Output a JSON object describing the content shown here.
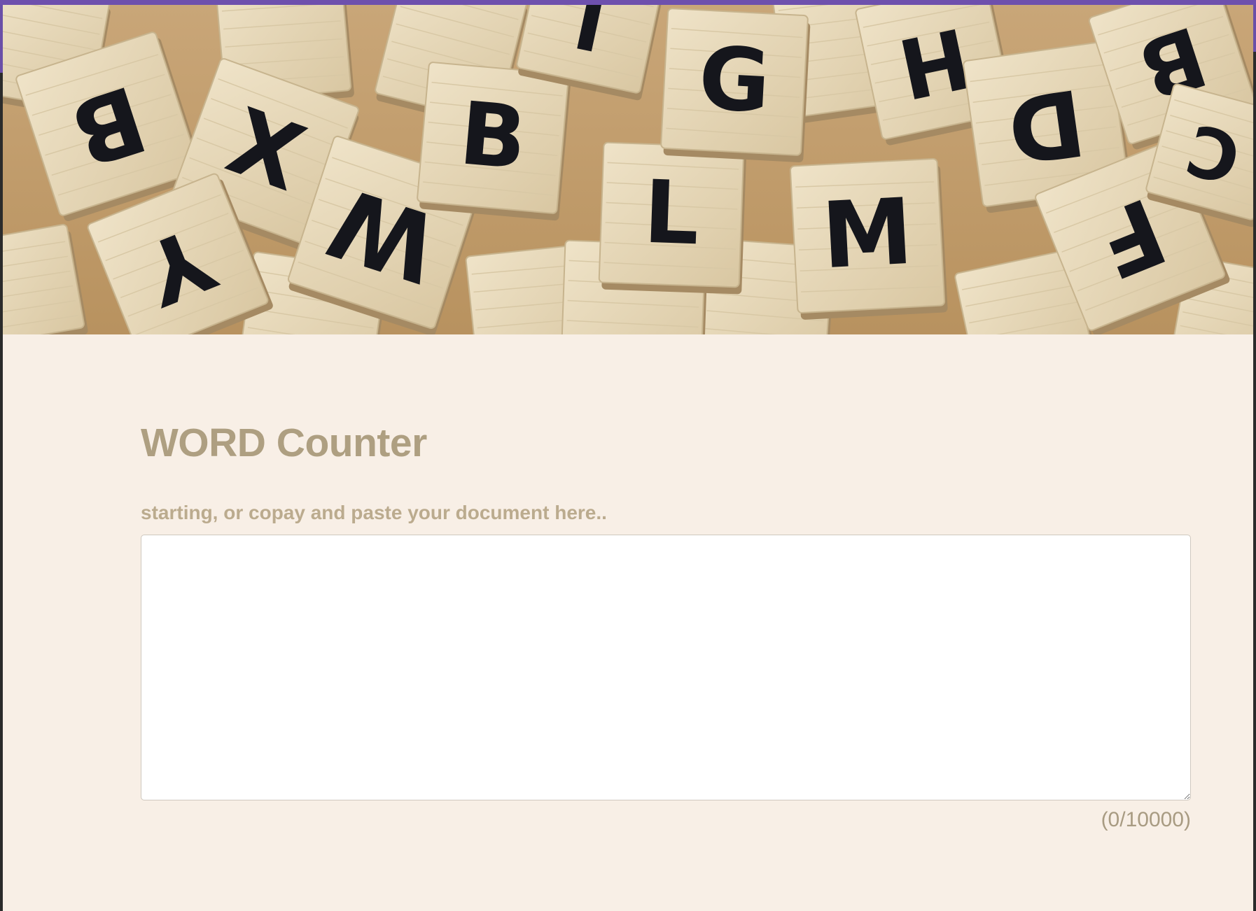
{
  "hero": {
    "image_icon": "letter-tiles-photo-icon",
    "tiles": [
      "B",
      "X",
      "Y",
      "W",
      "B",
      "L",
      "M",
      "G",
      "H",
      "D",
      "B",
      "F",
      "C",
      "J"
    ]
  },
  "page": {
    "title": "WORD Counter",
    "prompt": "starting, or copay and paste your document here..",
    "textarea_value": "",
    "counter": "(0/10000)"
  },
  "colors": {
    "accent_bar": "#6e50ad",
    "background": "#f8efe6",
    "title": "#ae9f81",
    "label": "#bbab8e"
  }
}
